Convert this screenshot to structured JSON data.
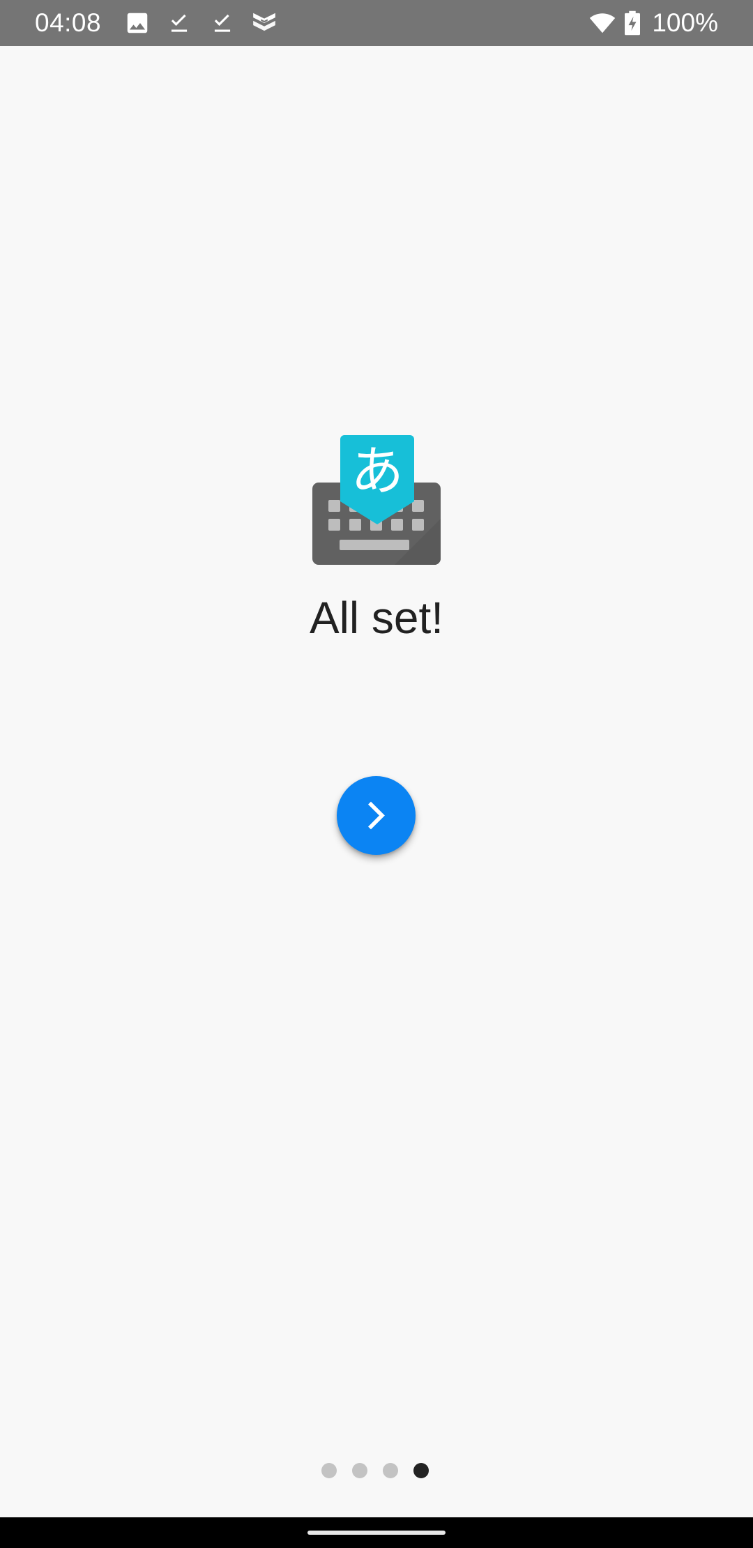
{
  "status_bar": {
    "time": "04:08",
    "battery": "100%",
    "icons": [
      "image-icon",
      "check-download-icon",
      "check-download-icon",
      "shield-app-icon",
      "wifi-icon",
      "battery-charging-icon"
    ],
    "background": "#757575"
  },
  "main": {
    "logo": {
      "icon": "gboard-japanese-keyboard-icon",
      "glyph": "あ",
      "glyph_color": "#ffffff",
      "tag_color": "#17bfd8",
      "keyboard_color": "#616161"
    },
    "title": "All set!",
    "next_button": {
      "icon": "chevron-right-icon",
      "color": "#0b84f3"
    }
  },
  "pagination": {
    "total": 4,
    "active_index": 3,
    "active_color": "#232323",
    "inactive_color": "#c3c3c3"
  }
}
